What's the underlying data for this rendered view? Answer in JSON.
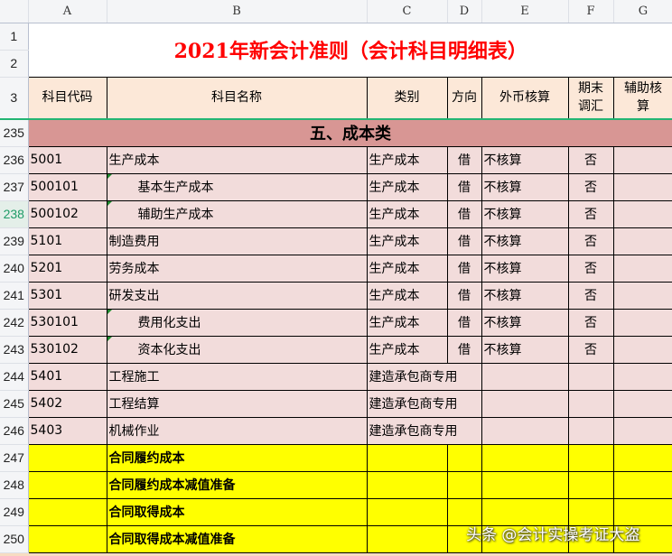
{
  "columns": [
    "A",
    "B",
    "C",
    "D",
    "E",
    "F",
    "G"
  ],
  "title": "2021年新会计准则（会计科目明细表）",
  "title_rows": [
    "1",
    "2"
  ],
  "header": {
    "row": "3",
    "cells": [
      "科目代码",
      "科目名称",
      "类别",
      "方向",
      "外币核算",
      "期末调汇",
      "辅助核算"
    ]
  },
  "section": {
    "row": "235",
    "label": "五、成本类"
  },
  "rows": [
    {
      "row": "236",
      "code": "5001",
      "name": "生产成本",
      "type": "生产成本",
      "dir": "借",
      "fx": "不核算",
      "adj": "否",
      "style": "pink"
    },
    {
      "row": "237",
      "code": "500101",
      "name": "基本生产成本",
      "type": "生产成本",
      "dir": "借",
      "fx": "不核算",
      "adj": "否",
      "style": "pink",
      "indent": true
    },
    {
      "row": "238",
      "code": "500102",
      "name": "辅助生产成本",
      "type": "生产成本",
      "dir": "借",
      "fx": "不核算",
      "adj": "否",
      "style": "pink",
      "indent": true,
      "selected": true
    },
    {
      "row": "239",
      "code": "5101",
      "name": "制造费用",
      "type": "生产成本",
      "dir": "借",
      "fx": "不核算",
      "adj": "否",
      "style": "pink"
    },
    {
      "row": "240",
      "code": "5201",
      "name": "劳务成本",
      "type": "生产成本",
      "dir": "借",
      "fx": "不核算",
      "adj": "否",
      "style": "pink"
    },
    {
      "row": "241",
      "code": "5301",
      "name": "研发支出",
      "type": "生产成本",
      "dir": "借",
      "fx": "不核算",
      "adj": "否",
      "style": "pink"
    },
    {
      "row": "242",
      "code": "530101",
      "name": "费用化支出",
      "type": "生产成本",
      "dir": "借",
      "fx": "不核算",
      "adj": "否",
      "style": "pink",
      "indent": true
    },
    {
      "row": "243",
      "code": "530102",
      "name": "资本化支出",
      "type": "生产成本",
      "dir": "借",
      "fx": "不核算",
      "adj": "否",
      "style": "pink",
      "indent": true
    },
    {
      "row": "244",
      "code": "5401",
      "name": "工程施工",
      "type": "建造承包商专用",
      "style": "pink",
      "merged": true
    },
    {
      "row": "245",
      "code": "5402",
      "name": "工程结算",
      "type": "建造承包商专用",
      "style": "pink",
      "merged": true
    },
    {
      "row": "246",
      "code": "5403",
      "name": "机械作业",
      "type": "建造承包商专用",
      "style": "pink",
      "merged": true
    },
    {
      "row": "247",
      "name": "合同履约成本",
      "style": "yellow"
    },
    {
      "row": "248",
      "name": "合同履约成本减值准备",
      "style": "yellow"
    },
    {
      "row": "249",
      "name": "合同取得成本",
      "style": "yellow"
    },
    {
      "row": "250",
      "name": "合同取得成本减值准备",
      "style": "yellow"
    }
  ],
  "watermark": "头条 @会计实操考证大盗"
}
